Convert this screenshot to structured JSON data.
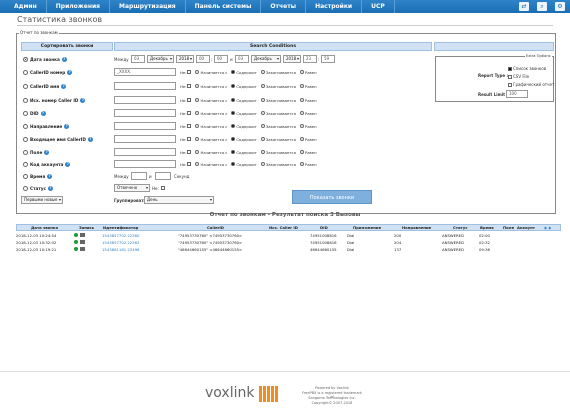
{
  "nav": {
    "items": [
      "Админ",
      "Приложения",
      "Маршрутизация",
      "Панель системы",
      "Отчеты",
      "Настройки",
      "UCP"
    ]
  },
  "page": {
    "title": "Статистика звонков"
  },
  "form": {
    "legend": "Отчет по звонкам",
    "sort_header": "Сортировать звонки",
    "search_header": "Search Conditions",
    "rows": [
      {
        "label": "Дата звонка"
      },
      {
        "label": "CallerID номер"
      },
      {
        "label": "CallerID имя"
      },
      {
        "label": "Исх. номер Caller ID"
      },
      {
        "label": "DID"
      },
      {
        "label": "Направление"
      },
      {
        "label": "Входящее имя CallerID"
      },
      {
        "label": "Поле"
      },
      {
        "label": "Код аккаунта"
      },
      {
        "label": "Время"
      },
      {
        "label": "Статус"
      }
    ],
    "date": {
      "from_label": "Между",
      "day1": "03",
      "month1": "Декабрь",
      "year1": "2018",
      "h1": "00",
      "m1": "00",
      "and": "и",
      "day2": "03",
      "month2": "Декабрь",
      "year2": "2018",
      "h2": "23",
      "m2": "59"
    },
    "callerid_value": "_XXXX.",
    "not_label": "Не:",
    "opts": [
      "Начинается с",
      "Содержит",
      "Заканчивается",
      "Равен"
    ],
    "time": {
      "from": "Между",
      "and": "и",
      "unit": "Секунд"
    },
    "status_value": "Отвечено",
    "order_value": "Первыми новые",
    "group_label": "Группировать по:",
    "group_value": "День",
    "submit": "Показать звонки"
  },
  "extra": {
    "legend": "Extra Options",
    "report_type": "Report Type :",
    "opt1": "Список звонков",
    "opt2": "CSV File",
    "opt3": "Графический отчет",
    "limit_label": "Result Limit :",
    "limit_value": "100"
  },
  "results": {
    "title": "Отчет по звонкам - Результат поиска 3 Вызовы",
    "columns": [
      "Дата звонка",
      "Запись",
      "Идентификатор",
      "CallerID",
      "Исх. Caller ID",
      "DID",
      "Приложение",
      "Направление",
      "Статус",
      "Время",
      "Поле",
      "Аккаунт"
    ],
    "rows": [
      {
        "date": "2018-12-03 10:24:54",
        "id": "1543857702.22560",
        "cid": "\"74953730760\" <74953730760>",
        "did": "74951008816",
        "app": "Dial",
        "dir": "200",
        "status": "ANSWERED",
        "time": "02:00"
      },
      {
        "date": "2018-12-03 10:32:02",
        "id": "1543857702.22562",
        "cid": "\"74953730760\" <74953730760>",
        "did": "74951008816",
        "app": "Dial",
        "dir": "204",
        "status": "ANSWERED",
        "time": "02:32"
      },
      {
        "date": "2018-12-03 10:19:21",
        "id": "1543861161.23498",
        "cid": "\"46644660155\" <46644660155>",
        "did": "46644660155",
        "app": "Dial",
        "dir": "137",
        "status": "ANSWERED",
        "time": "09:36"
      }
    ]
  },
  "footer": {
    "logo": "voxlink",
    "line1": "Powered by Voxlink",
    "line2": "FreePBX is a registered trademark of",
    "line3": "Sangoma Technologies Inc.",
    "line4": "Copyright© 2007-2018"
  }
}
